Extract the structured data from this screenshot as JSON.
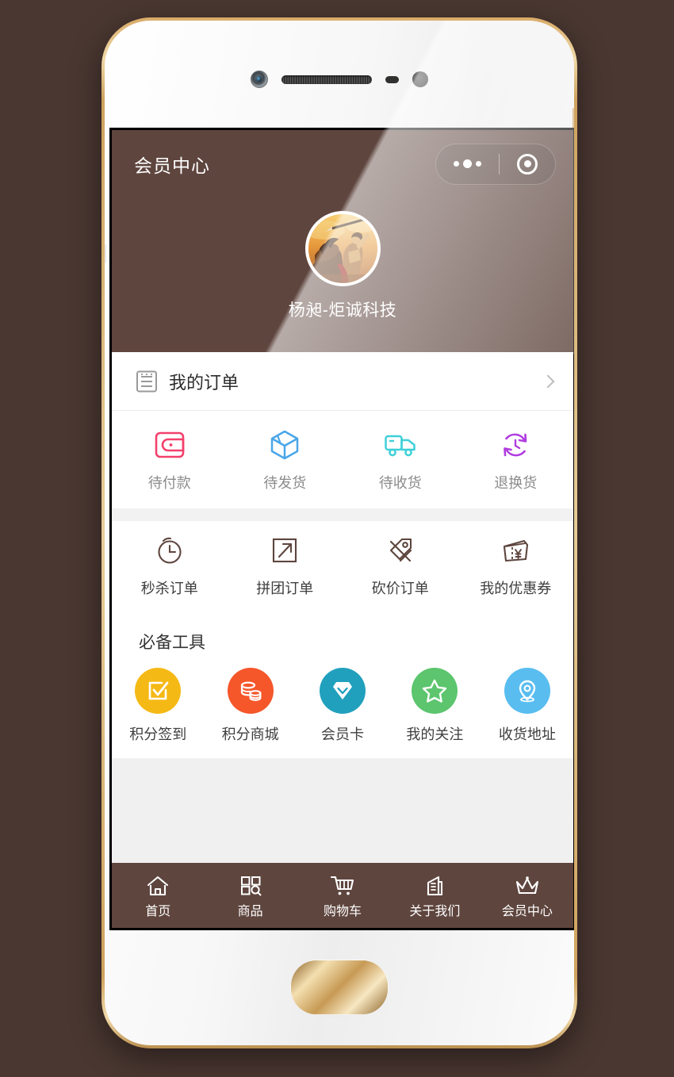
{
  "header": {
    "title": "会员中心",
    "capsule": {
      "more_icon": "more-dots-icon",
      "target_icon": "target-circle-icon"
    }
  },
  "profile": {
    "avatar_icon": "avatar-warrior-horse",
    "name": "杨昶-炬诚科技"
  },
  "orders": {
    "section_icon": "order-list-icon",
    "section_label": "我的订单",
    "chevron_icon": "chevron-right-icon",
    "statuses": [
      {
        "label": "待付款",
        "icon": "wallet-icon",
        "color": "#f2416c"
      },
      {
        "label": "待发货",
        "icon": "box-icon",
        "color": "#4aa6e8"
      },
      {
        "label": "待收货",
        "icon": "truck-icon",
        "color": "#3fd0d8"
      },
      {
        "label": "退换货",
        "icon": "refresh-icon",
        "color": "#b03de0"
      }
    ]
  },
  "order_types": {
    "items": [
      {
        "label": "秒杀订单",
        "icon": "alarm-clock-icon",
        "color": "#5e453e"
      },
      {
        "label": "拼团订单",
        "icon": "arrow-box-icon",
        "color": "#5e453e"
      },
      {
        "label": "砍价订单",
        "icon": "price-tag-icon",
        "color": "#5e453e"
      },
      {
        "label": "我的优惠券",
        "icon": "coupon-yen-icon",
        "color": "#5e453e"
      }
    ]
  },
  "tools": {
    "title": "必备工具",
    "items": [
      {
        "label": "积分签到",
        "icon": "checkbox-check-icon",
        "color": "#f5b916"
      },
      {
        "label": "积分商城",
        "icon": "coins-stack-icon",
        "color": "#f5562a"
      },
      {
        "label": "会员卡",
        "icon": "diamond-icon",
        "color": "#21a0bd"
      },
      {
        "label": "我的关注",
        "icon": "star-icon",
        "color": "#5cc56e"
      },
      {
        "label": "收货地址",
        "icon": "location-pin-icon",
        "color": "#59bdf0"
      }
    ]
  },
  "tabbar": {
    "items": [
      {
        "label": "首页",
        "icon": "home-icon"
      },
      {
        "label": "商品",
        "icon": "grid-search-icon"
      },
      {
        "label": "购物车",
        "icon": "shopping-cart-icon"
      },
      {
        "label": "关于我们",
        "icon": "building-icon"
      },
      {
        "label": "会员中心",
        "icon": "crown-icon"
      }
    ],
    "active": "会员中心"
  },
  "theme": {
    "page_background": "#4a3731",
    "brand_brown": "#5e453e",
    "panel_white": "#ffffff",
    "gap_gray": "#f2f2f2",
    "filler_gray": "#f0f0f0"
  },
  "device": {
    "home_button_icon": "home-button",
    "front_camera_icon": "front-camera-icon",
    "speaker_icon": "earpiece-speaker-icon"
  }
}
